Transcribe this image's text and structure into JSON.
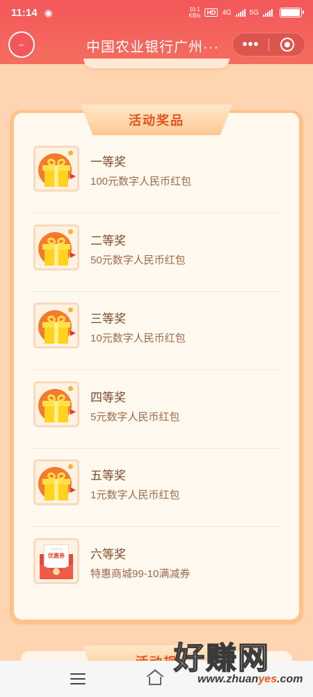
{
  "status_bar": {
    "time": "11:14",
    "wechat_icon": "wechat-icon",
    "net_speed": "10.1",
    "net_unit": "KB/s",
    "hd_badge": "HD",
    "signal1_label": "4G",
    "signal2_label": "5G",
    "battery_level": 0.95
  },
  "nav": {
    "title": "中国农业银行广州···",
    "more_icon": "more-dots-icon",
    "close_icon": "target-close-icon"
  },
  "prize_section": {
    "title": "活动奖品",
    "prizes": [
      {
        "title": "一等奖",
        "desc": "100元数字人民币红包",
        "icon": "gift-icon"
      },
      {
        "title": "二等奖",
        "desc": "50元数字人民币红包",
        "icon": "gift-icon"
      },
      {
        "title": "三等奖",
        "desc": "10元数字人民币红包",
        "icon": "gift-icon"
      },
      {
        "title": "四等奖",
        "desc": "5元数字人民币红包",
        "icon": "gift-icon"
      },
      {
        "title": "五等奖",
        "desc": "1元数字人民币红包",
        "icon": "gift-icon"
      },
      {
        "title": "六等奖",
        "desc": "特惠商城99-10满减券",
        "icon": "coupon-icon",
        "coupon_en": "COUPON",
        "coupon_cn": "优惠券"
      }
    ]
  },
  "next_section": {
    "title_partial": "活动规"
  },
  "bottom_nav": {
    "menu_icon": "menu-icon",
    "home_icon": "home-icon"
  },
  "watermark": {
    "big": "好赚网",
    "url_pre": "www.zhuan",
    "url_hl": "yes",
    "url_post": ".com"
  },
  "colors": {
    "header": "#F3575A",
    "background": "#FFD4B1",
    "panel": "#FFF9EF",
    "accent_text": "#E2541E"
  }
}
